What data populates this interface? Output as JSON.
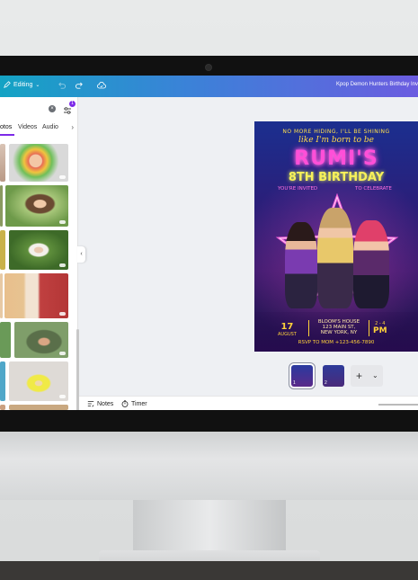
{
  "toolbar": {
    "mode_label": "Editing",
    "document_title": "Kpop Demon Hunters Birthday Inv"
  },
  "side_panel": {
    "tabs": [
      "otos",
      "Videos",
      "Audio"
    ],
    "filter_badge": "1"
  },
  "bottom_bar": {
    "notes_label": "Notes",
    "timer_label": "Timer"
  },
  "invitation": {
    "tagline": "NO MORE HIDING, I'LL BE SHINING",
    "script_line": "like I'm born to be",
    "name": "RUMI'S",
    "headline": "8TH BIRTHDAY",
    "invited": "YOU'RE INVITED",
    "celebrate": "TO CELEBRATE",
    "date_day": "17",
    "date_month": "AUGUST",
    "venue_name": "BLOOM'S HOUSE",
    "venue_street": "123 MAIN ST,",
    "venue_city": "NEW YORK, NY",
    "time_range": "2 - 4",
    "time_period": "PM",
    "rsvp": "RSVP TO MOM +123-456-7890"
  },
  "pages": {
    "thumb1_number": "1",
    "thumb2_number": "2"
  },
  "colors": {
    "topbar_start": "#14a3c4",
    "topbar_end": "#6b5ce0",
    "accent": "#7d2ae8",
    "neon_pink": "#ff4fd8",
    "neon_yellow": "#f7f05a"
  }
}
